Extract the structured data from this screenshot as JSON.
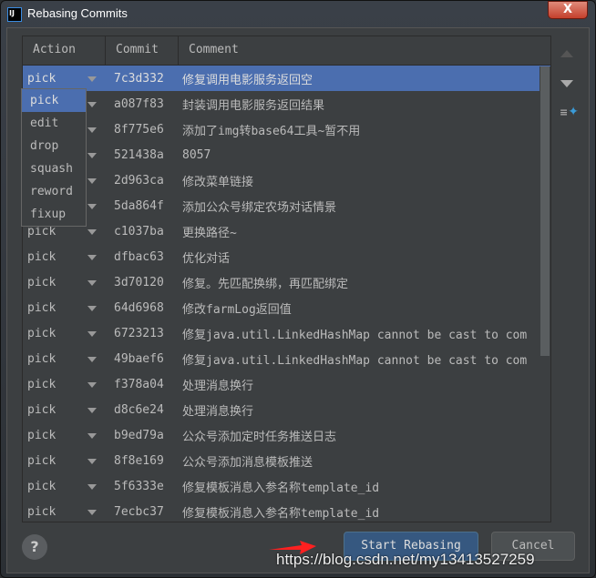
{
  "window": {
    "title": "Rebasing Commits",
    "logo": "IJ",
    "close_label": "X"
  },
  "table": {
    "headers": [
      "Action",
      "Commit",
      "Comment"
    ],
    "rows": [
      {
        "action": "pick",
        "commit": "7c3d332",
        "comment": "修复调用电影服务返回空"
      },
      {
        "action": "pick",
        "commit": "a087f83",
        "comment": "封装调用电影服务返回结果"
      },
      {
        "action": "pick",
        "commit": "8f775e6",
        "comment": "添加了img转base64工具~暂不用"
      },
      {
        "action": "pick",
        "commit": "521438a",
        "comment": "8057"
      },
      {
        "action": "pick",
        "commit": "2d963ca",
        "comment": "修改菜单链接"
      },
      {
        "action": "pick",
        "commit": "5da864f",
        "comment": "添加公众号绑定农场对话情景"
      },
      {
        "action": "pick",
        "commit": "c1037ba",
        "comment": "更换路径~"
      },
      {
        "action": "pick",
        "commit": "dfbac63",
        "comment": "优化对话"
      },
      {
        "action": "pick",
        "commit": "3d70120",
        "comment": "修复。先匹配换绑，再匹配绑定"
      },
      {
        "action": "pick",
        "commit": "64d6968",
        "comment": "修改farmLog返回值"
      },
      {
        "action": "pick",
        "commit": "6723213",
        "comment": "修复java.util.LinkedHashMap cannot be cast to com"
      },
      {
        "action": "pick",
        "commit": "49baef6",
        "comment": "修复java.util.LinkedHashMap cannot be cast to com"
      },
      {
        "action": "pick",
        "commit": "f378a04",
        "comment": "处理消息换行"
      },
      {
        "action": "pick",
        "commit": "d8c6e24",
        "comment": "处理消息换行"
      },
      {
        "action": "pick",
        "commit": "b9ed79a",
        "comment": "公众号添加定时任务推送日志"
      },
      {
        "action": "pick",
        "commit": "8f8e169",
        "comment": "公众号添加消息模板推送"
      },
      {
        "action": "pick",
        "commit": "5f6333e",
        "comment": "修复模板消息入参名称template_id"
      },
      {
        "action": "pick",
        "commit": "7ecbc37",
        "comment": "修复模板消息入参名称template_id"
      }
    ]
  },
  "dropdown": {
    "options": [
      "pick",
      "edit",
      "drop",
      "squash",
      "reword",
      "fixup"
    ],
    "selected": "pick"
  },
  "side": {
    "icons": [
      "move-up-icon",
      "move-down-icon",
      "squash-icon"
    ]
  },
  "buttons": {
    "help": "?",
    "start": "Start Rebasing",
    "cancel": "Cancel"
  },
  "watermark": "https://blog.csdn.net/my13413527259",
  "colors": {
    "selection": "#4b6eaf",
    "background": "#3c3f41",
    "primary_button": "#365880",
    "annotation_arrow": "#ff2020"
  }
}
